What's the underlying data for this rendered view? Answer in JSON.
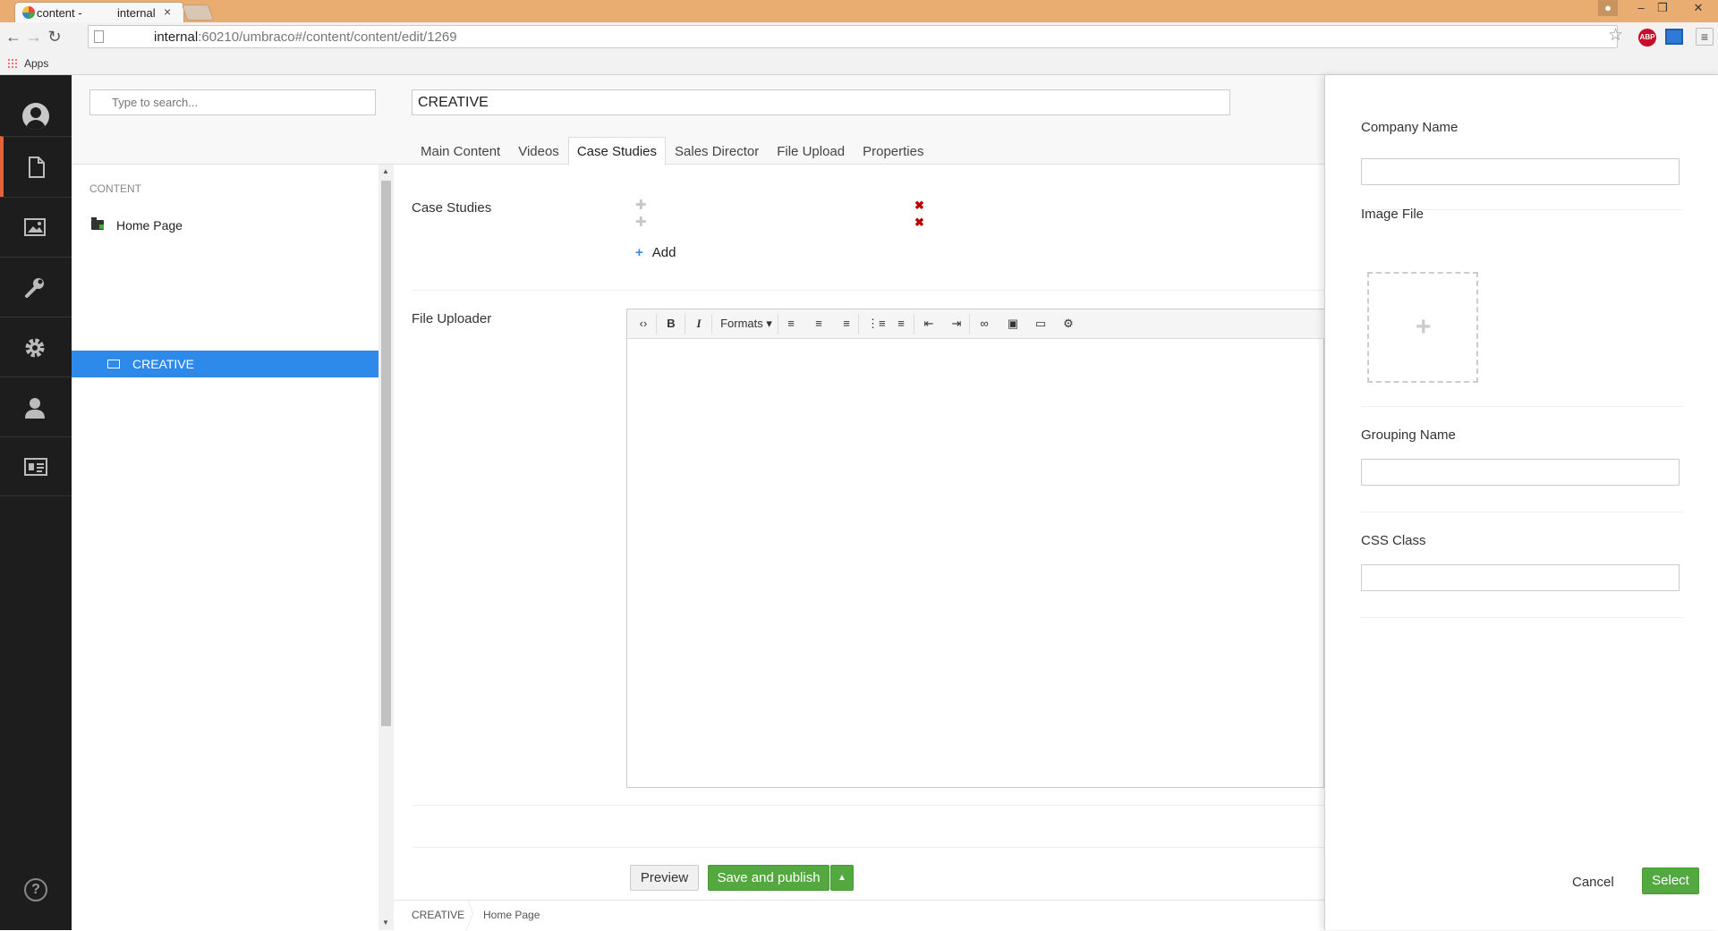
{
  "browser": {
    "tab_title_left": "content -",
    "tab_title_right": "internal",
    "tab_close": "×",
    "url_host": "internal",
    "url_rest": ":60210/umbraco#/content/content/edit/1269",
    "bookmarks_apps": "Apps",
    "ext_abp": "ABP"
  },
  "tree": {
    "search_placeholder": "Type to search...",
    "section_title": "CONTENT",
    "nodes": [
      {
        "label": "Home Page",
        "icon": "folder-icon"
      },
      {
        "label": "CREATIVE",
        "icon": "doc-image-icon",
        "selected": true
      }
    ]
  },
  "editor": {
    "node_name": "CREATIVE",
    "tabs": [
      "Main Content",
      "Videos",
      "Case Studies",
      "Sales Director",
      "File Upload",
      "Properties"
    ],
    "active_tab": "Case Studies",
    "case_studies_label": "Case Studies",
    "add_label": "Add",
    "file_uploader_label": "File Uploader",
    "rte_formats": "Formats",
    "preview_label": "Preview",
    "publish_label": "Save and publish",
    "breadcrumb": [
      "CREATIVE",
      "Home Page"
    ]
  },
  "dialog": {
    "company_name_label": "Company Name",
    "image_file_label": "Image File",
    "grouping_name_label": "Grouping Name",
    "css_class_label": "CSS Class",
    "cancel_label": "Cancel",
    "select_label": "Select"
  },
  "colors": {
    "accent_orange": "#e0653d",
    "selected_blue": "#2e8aea",
    "success_green": "#53a93f",
    "nav_dark": "#1d1d1d"
  }
}
